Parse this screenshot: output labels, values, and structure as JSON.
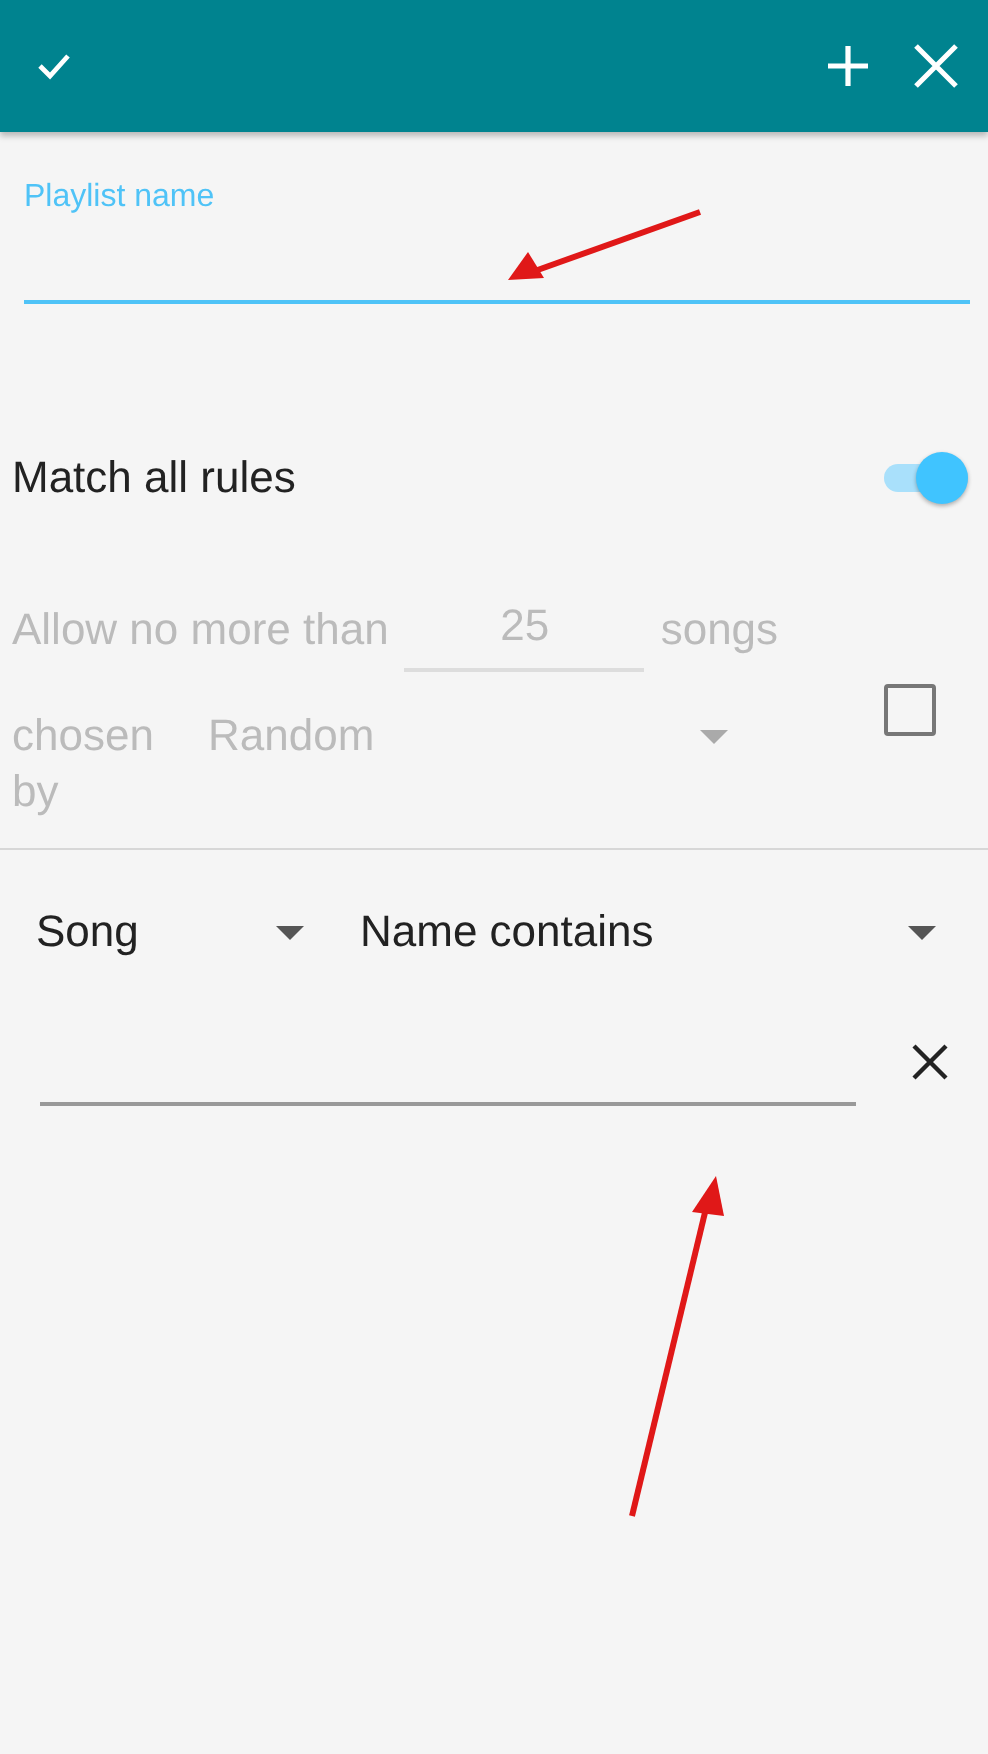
{
  "toolbar": {
    "actions": [
      {
        "kind": "add"
      },
      {
        "kind": "close"
      }
    ]
  },
  "playlist_name": {
    "placeholder": "Playlist name"
  },
  "match_all": {
    "label": "Match all rules",
    "on": true
  },
  "limit": {
    "enabled": false,
    "prefix": "Allow no more than",
    "value": "25",
    "suffix": "songs",
    "chosen_label": "chosen by",
    "chosen_value": "Random"
  },
  "rules": [
    {
      "field": "Song",
      "operator": "Name contains"
    }
  ]
}
